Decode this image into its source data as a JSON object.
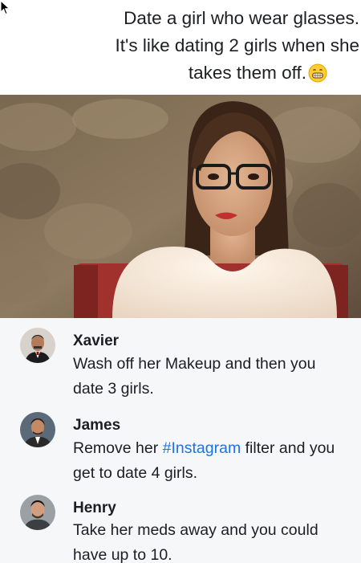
{
  "post": {
    "caption_line1": "Date a girl who wear glasses.",
    "caption_line2": "It's like dating 2 girls when she",
    "caption_line3": "takes them off.",
    "emoji": "grinning-face-emoji"
  },
  "comments": [
    {
      "author": "Xavier",
      "text_line1": "Wash off her Makeup and then you",
      "text_line2": "date 3 girls."
    },
    {
      "author": "James",
      "text_pre": "Remove her ",
      "hashtag": "#Instagram",
      "text_post": " filter and you",
      "text_line2": "get to date 4 girls."
    },
    {
      "author": "Henry",
      "text_line1": "Take her meds away and you could",
      "text_line2": "have up to 10."
    }
  ],
  "colors": {
    "hashtag": "#1b74e4",
    "comment_bg": "#f0f2f5",
    "text": "#1c1e21"
  }
}
